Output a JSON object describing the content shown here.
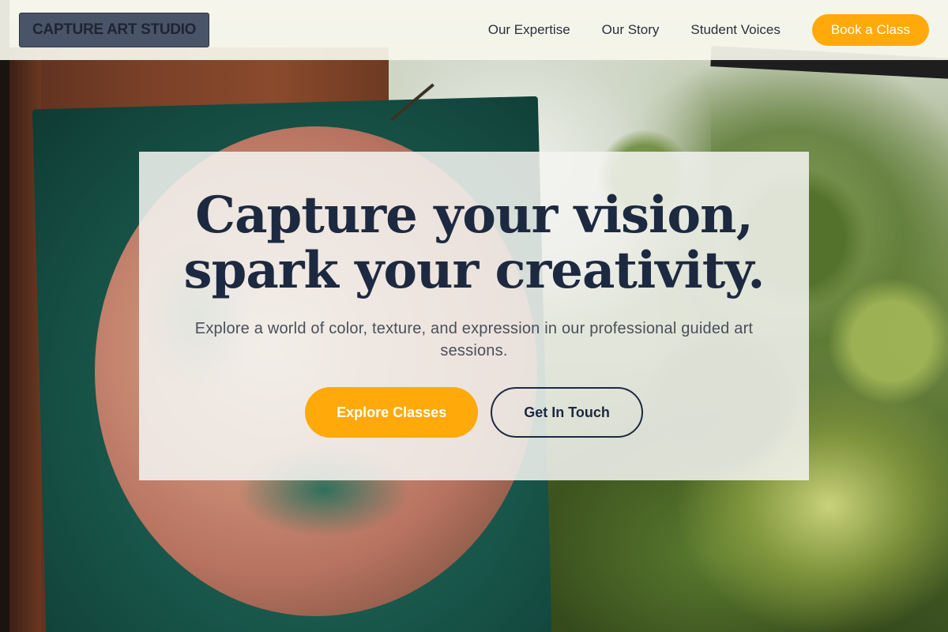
{
  "brand": {
    "name": "CAPTURE ART STUDIO"
  },
  "nav": {
    "items": [
      {
        "label": "Our Expertise"
      },
      {
        "label": "Our Story"
      },
      {
        "label": "Student Voices"
      }
    ],
    "cta_label": "Book a Class"
  },
  "hero": {
    "title_line1": "Capture your vision,",
    "title_line2": "spark your creativity.",
    "subtitle": "Explore a world of color, texture, and expression in our professional guided art sessions.",
    "primary_button": "Explore Classes",
    "secondary_button": "Get In Touch"
  },
  "colors": {
    "accent": "#ffa90a",
    "navy": "#1d2940",
    "header_bg": "#f6f6ec"
  }
}
